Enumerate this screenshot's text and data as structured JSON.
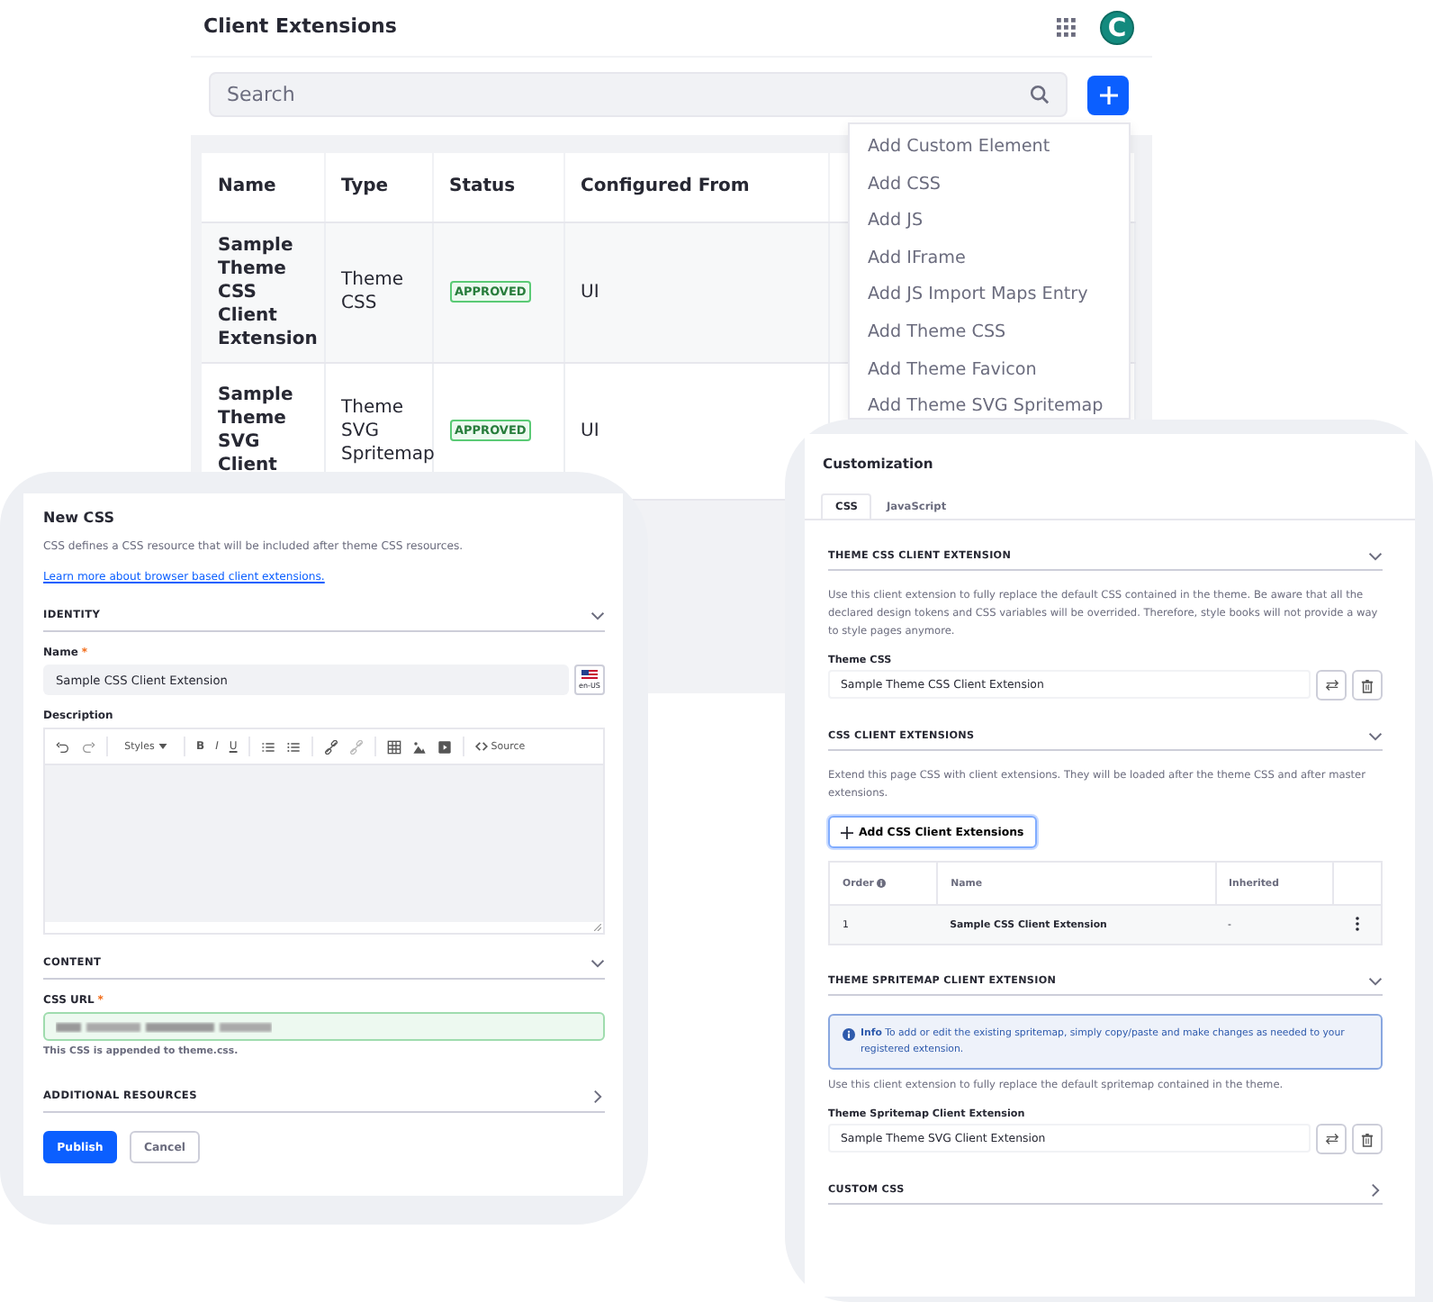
{
  "app": {
    "title": "Client Extensions",
    "avatar": "C",
    "search": {
      "placeholder": "Search"
    },
    "table": {
      "columns": [
        "Name",
        "Type",
        "Status",
        "Configured From"
      ],
      "rows": [
        {
          "name": "Sample Theme CSS Client Extension",
          "type": "Theme CSS",
          "status": "APPROVED",
          "configured_from": "UI"
        },
        {
          "name": "Sample Theme SVG Client",
          "type": "Theme SVG Spritemap",
          "status": "APPROVED",
          "configured_from": "UI"
        }
      ]
    },
    "menu": [
      "Add Custom Element",
      "Add CSS",
      "Add JS",
      "Add IFrame",
      "Add JS Import Maps Entry",
      "Add Theme CSS",
      "Add Theme Favicon",
      "Add Theme SVG Spritemap"
    ]
  },
  "new_css": {
    "title": "New CSS",
    "description": "CSS defines a CSS resource that will be included after theme CSS resources.",
    "link": "Learn more about browser based client extensions.",
    "identity": {
      "heading": "IDENTITY",
      "expanded": true,
      "name_label": "Name",
      "required_mark": "*",
      "name_value": "Sample CSS Client Extension",
      "locale": "en-US",
      "description_label": "Description",
      "toolbar": [
        {
          "kind": "undo"
        },
        {
          "kind": "redo"
        },
        {
          "kind": "divider"
        },
        {
          "kind": "styles",
          "label": "Styles"
        },
        {
          "kind": "divider"
        },
        {
          "kind": "bold",
          "label": "B"
        },
        {
          "kind": "italic",
          "label": "I"
        },
        {
          "kind": "underline",
          "label": "U"
        },
        {
          "kind": "divider"
        },
        {
          "kind": "ordered-list"
        },
        {
          "kind": "bullet-list"
        },
        {
          "kind": "divider"
        },
        {
          "kind": "link"
        },
        {
          "kind": "unlink"
        },
        {
          "kind": "divider"
        },
        {
          "kind": "table"
        },
        {
          "kind": "image"
        },
        {
          "kind": "video"
        },
        {
          "kind": "divider"
        },
        {
          "kind": "source",
          "label": "Source"
        }
      ]
    },
    "content": {
      "heading": "CONTENT",
      "expanded": true,
      "url_label": "CSS URL",
      "required_mark": "*",
      "valid": true,
      "help": "This CSS is appended to theme.css."
    },
    "additional": {
      "heading": "ADDITIONAL RESOURCES",
      "expanded": false
    },
    "buttons": [
      {
        "label": "Publish",
        "kind": "primary"
      },
      {
        "label": "Cancel",
        "kind": "secondary"
      }
    ]
  },
  "customization": {
    "title": "Customization",
    "tabs": [
      {
        "label": "CSS",
        "selected": true
      },
      {
        "label": "JavaScript",
        "selected": false
      }
    ],
    "sections": [
      {
        "heading": "THEME CSS CLIENT EXTENSION",
        "expanded": true,
        "text": "Use this client extension to fully replace the default CSS contained in the theme. Be aware that all the declared design tokens and CSS variables will be overrided. Therefore, style books will not provide a way to style pages anymore.",
        "field_label": "Theme CSS",
        "field_value": "Sample Theme CSS Client Extension"
      },
      {
        "heading": "CSS CLIENT EXTENSIONS",
        "expanded": true,
        "text": "Extend this page CSS with client extensions. They will be loaded after the theme CSS and after master extensions.",
        "button": "Add CSS Client Extensions",
        "table": {
          "columns": [
            "Order",
            "Name",
            "Inherited"
          ],
          "rows": [
            {
              "order": "1",
              "name": "Sample CSS Client Extension",
              "inherited": "-"
            }
          ]
        }
      },
      {
        "heading": "THEME SPRITEMAP CLIENT EXTENSION",
        "expanded": true,
        "info": "**Info** To add or edit the existing spritemap, simply copy/paste and make changes as needed to your registered extension.",
        "text": "Use this client extension to fully replace the default spritemap contained in the theme.",
        "field_label": "Theme Spritemap Client Extension",
        "field_value": "Sample Theme SVG Client Extension"
      },
      {
        "heading": "CUSTOM CSS",
        "expanded": false
      }
    ]
  }
}
